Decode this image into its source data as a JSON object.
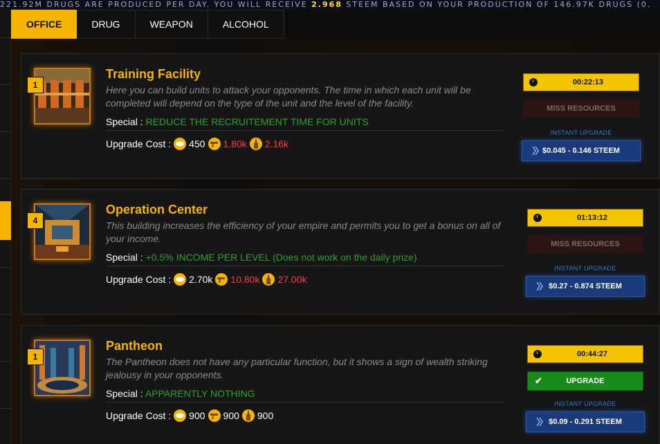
{
  "ticker": {
    "before": "221.92M DRUGS ARE PRODUCED PER DAY. YOU WILL RECEIVE ",
    "highlight": "2.968",
    "after": " STEEM BASED ON YOUR PRODUCTION OF 146.97K DRUGS (0."
  },
  "tabs": [
    {
      "label": "OFFICE"
    },
    {
      "label": "DRUG"
    },
    {
      "label": "WEAPON"
    },
    {
      "label": "ALCOHOL"
    }
  ],
  "special_label": "Special : ",
  "cost_label": "Upgrade Cost : ",
  "instant_label": "INSTANT UPGRADE",
  "cards": [
    {
      "level": "1",
      "title": "Training Facility",
      "desc": "Here you can build units to attack your opponents. The time in which each unit will be completed will depend on the type of the unit and the level of the facility.",
      "special": "REDUCE THE RECRUITEMENT TIME FOR UNITS",
      "cost": [
        "450",
        "1.80k",
        "2.16k"
      ],
      "timer": "00:22:13",
      "action": "MISS RESOURCES",
      "steem": "$0.045 - 0.146 STEEM"
    },
    {
      "level": "4",
      "title": "Operation Center",
      "desc": "This building increases the efficiency of your empire and permits you to get a bonus on all of your income.",
      "special": "+0.5% INCOME PER LEVEL (Does not work on the daily prize)",
      "cost": [
        "2.70k",
        "10.80k",
        "27.00k"
      ],
      "timer": "01:13:12",
      "action": "MISS RESOURCES",
      "steem": "$0.27 - 0.874 STEEM"
    },
    {
      "level": "1",
      "title": "Pantheon",
      "desc": "The Pantheon does not have any particular function, but it shows a sign of wealth striking jealousy in your opponents.",
      "special": "APPARENTLY NOTHING",
      "cost": [
        "900",
        "900",
        "900"
      ],
      "timer": "00:44:27",
      "action": "UPGRADE",
      "steem": "$0.09 - 0.291 STEEM"
    }
  ]
}
